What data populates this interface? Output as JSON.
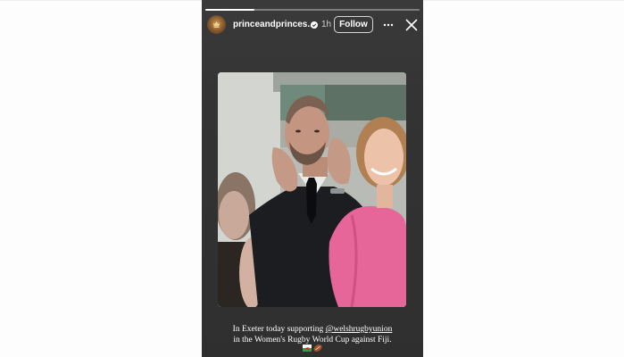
{
  "story": {
    "username": "princeandprinces...",
    "time": "1h",
    "follow_label": "Follow",
    "progress": 0.23,
    "caption": {
      "line1_prefix": "In Exeter today supporting ",
      "mention": "@welshrugbyunion",
      "line2": "in the Women's Rugby World Cup against Fiji.",
      "emojis": [
        "wales-flag",
        "rugby-ball"
      ]
    }
  },
  "icons": {
    "avatar": "royal-crest-icon",
    "verified": "verified-badge-icon",
    "more": "more-options-icon",
    "close": "close-icon"
  },
  "colors": {
    "story_background": "#333333",
    "verified": "#ffffff",
    "text": "#ffffff"
  }
}
